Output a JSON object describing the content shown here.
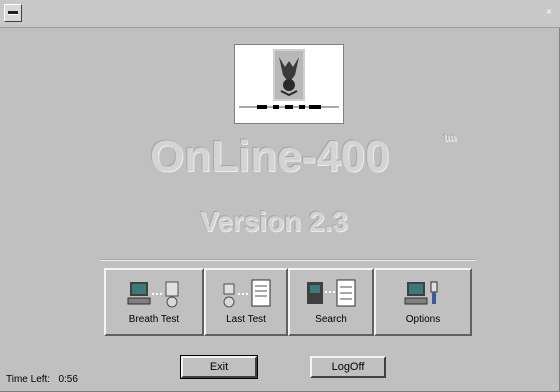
{
  "titlebar": {
    "close_glyph": "×"
  },
  "app": {
    "name": "OnLine-400",
    "trademark": "tm",
    "version": "Version 2.3"
  },
  "toolbar": {
    "breath_test": "Breath Test",
    "last_test": "Last Test",
    "search": "Search",
    "options": "Options"
  },
  "buttons": {
    "exit": "Exit",
    "logoff": "LogOff"
  },
  "status": {
    "time_left_label": "Time Left:",
    "time_left_value": "0:56"
  }
}
